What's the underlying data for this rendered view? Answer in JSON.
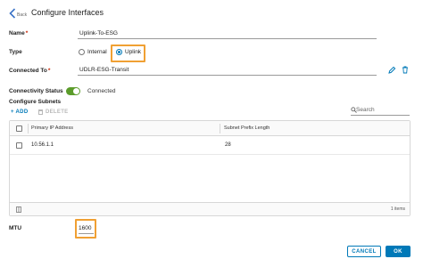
{
  "header": {
    "back_label": "Back",
    "title": "Configure Interfaces"
  },
  "form": {
    "name_label": "Name",
    "name_value": "Uplink-To-ESG",
    "type_label": "Type",
    "type_options": [
      "Internal",
      "Uplink"
    ],
    "type_selected": "Uplink",
    "connected_to_label": "Connected To",
    "connected_to_value": "UDLR-ESG-Transit",
    "connectivity_label": "Connectivity Status",
    "connectivity_value": "Connected",
    "subnets_title": "Configure Subnets",
    "mtu_label": "MTU",
    "mtu_value": "1600"
  },
  "toolbar": {
    "add_label": "+ ADD",
    "delete_label": "DELETE",
    "search_placeholder": "Search"
  },
  "grid": {
    "columns": [
      "Primary IP Address",
      "Subnet Prefix Length"
    ],
    "rows": [
      {
        "ip": "10.56.1.1",
        "prefix": "28"
      }
    ],
    "footer_count": "1 items"
  },
  "actions": {
    "cancel_label": "CANCEL",
    "ok_label": "OK"
  },
  "colors": {
    "accent": "#0079b8",
    "highlight": "#f0a033",
    "toggle_on": "#5b9c2a",
    "required": "#c92100"
  },
  "icons": [
    "chevron-left-icon",
    "pencil-icon",
    "trash-icon",
    "search-icon",
    "column-toggle-icon"
  ]
}
